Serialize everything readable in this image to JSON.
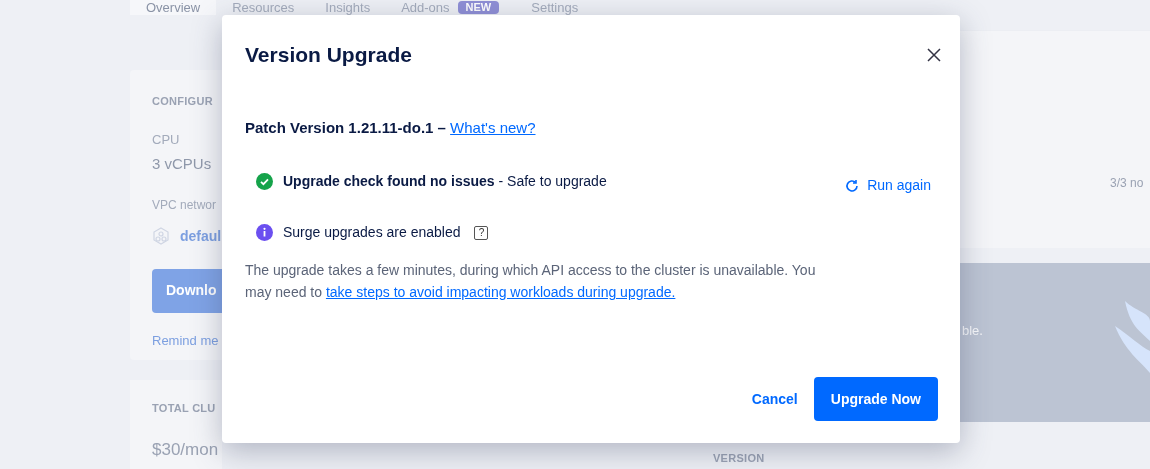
{
  "background": {
    "tabs": [
      {
        "label": "Overview",
        "selected": true
      },
      {
        "label": "Resources",
        "selected": false
      },
      {
        "label": "Insights",
        "selected": false
      },
      {
        "label": "Add-ons",
        "badge": "NEW",
        "selected": false
      },
      {
        "label": "Settings",
        "selected": false
      }
    ],
    "config_card": {
      "heading": "CONFIGUR",
      "cpu_label": "CPU",
      "cpu_value": "3 vCPUs",
      "vpc_label": "VPC networ",
      "vpc_value": "defaul",
      "button": "Downlo",
      "link": "Remind me"
    },
    "cost_card": {
      "heading": "TOTAL CLU",
      "value": "$30/mon"
    },
    "nodes_text": "3/3 no",
    "panel_text": "ble.",
    "version_label": "VERSION"
  },
  "dialog": {
    "title": "Version Upgrade",
    "patch": {
      "text": "Patch Version 1.21.11-do.1 – ",
      "link": "What's new?"
    },
    "check": {
      "text": "**Upgrade check found no issues** - Safe to upgrade",
      "action": "Run again"
    },
    "surge": {
      "text": "Surge upgrades are enabled",
      "help": "?"
    },
    "description": {
      "text": "The upgrade takes a few minutes, during which API access to the cluster is unavailable. You may need to ",
      "link": "take steps to avoid impacting workloads during upgrade."
    },
    "buttons": [
      {
        "label": "Cancel",
        "kind": "link"
      },
      {
        "label": "Upgrade Now",
        "kind": "primary"
      }
    ]
  }
}
